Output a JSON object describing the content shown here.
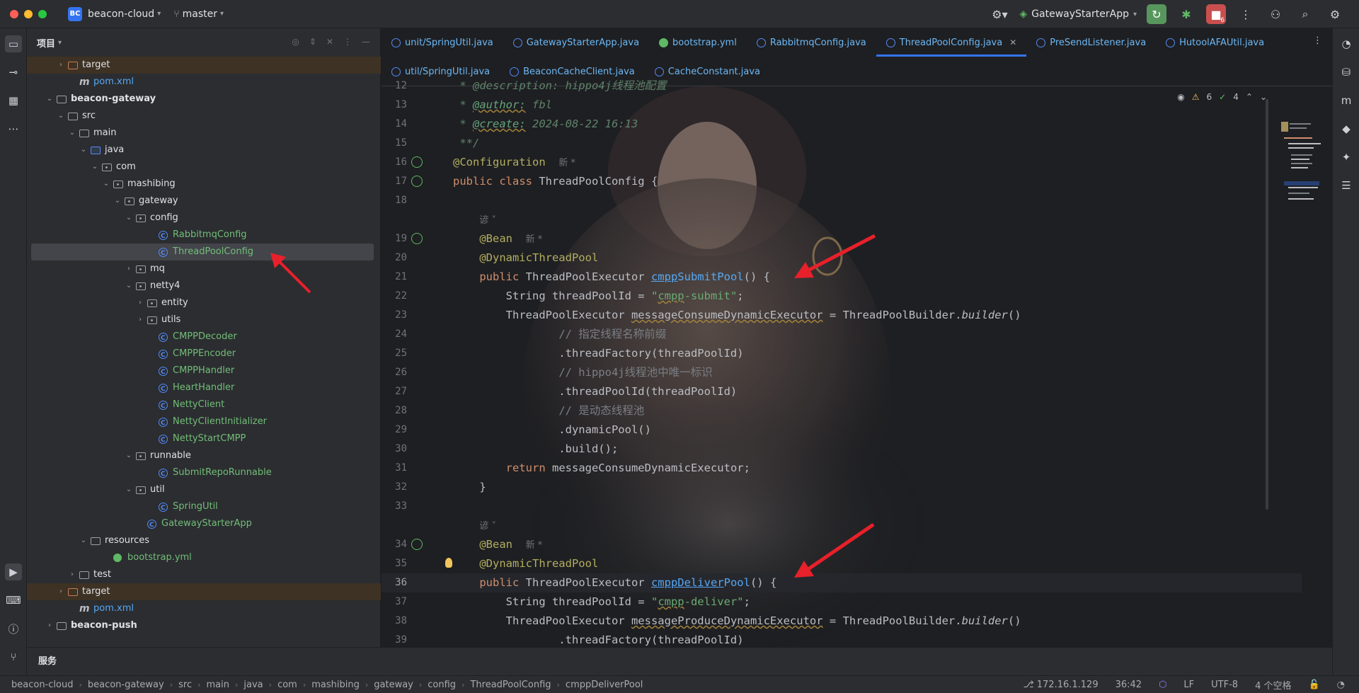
{
  "titlebar": {
    "project_badge": "BC",
    "project_name": "beacon-cloud",
    "branch": "master",
    "run_config": "GatewayStarterApp",
    "stop_count": "6"
  },
  "project_panel": {
    "title": "项目",
    "tree": [
      {
        "label": "target",
        "level": 1,
        "kind": "folder-excluded",
        "arrow": "right",
        "excluded": true
      },
      {
        "label": "pom.xml",
        "level": 2,
        "kind": "maven"
      },
      {
        "label": "beacon-gateway",
        "level": 0,
        "kind": "module",
        "arrow": "down",
        "bold": true
      },
      {
        "label": "src",
        "level": 1,
        "kind": "folder",
        "arrow": "down"
      },
      {
        "label": "main",
        "level": 2,
        "kind": "folder",
        "arrow": "down"
      },
      {
        "label": "java",
        "level": 3,
        "kind": "folder-src",
        "arrow": "down"
      },
      {
        "label": "com",
        "level": 4,
        "kind": "package",
        "arrow": "down"
      },
      {
        "label": "mashibing",
        "level": 5,
        "kind": "package",
        "arrow": "down"
      },
      {
        "label": "gateway",
        "level": 6,
        "kind": "package",
        "arrow": "down"
      },
      {
        "label": "config",
        "level": 7,
        "kind": "package",
        "arrow": "down"
      },
      {
        "label": "RabbitmqConfig",
        "level": 9,
        "kind": "class"
      },
      {
        "label": "ThreadPoolConfig",
        "level": 9,
        "kind": "class",
        "selected": true
      },
      {
        "label": "mq",
        "level": 7,
        "kind": "package",
        "arrow": "right"
      },
      {
        "label": "netty4",
        "level": 7,
        "kind": "package",
        "arrow": "down"
      },
      {
        "label": "entity",
        "level": 8,
        "kind": "package",
        "arrow": "right"
      },
      {
        "label": "utils",
        "level": 8,
        "kind": "package",
        "arrow": "right"
      },
      {
        "label": "CMPPDecoder",
        "level": 9,
        "kind": "class"
      },
      {
        "label": "CMPPEncoder",
        "level": 9,
        "kind": "class"
      },
      {
        "label": "CMPPHandler",
        "level": 9,
        "kind": "class"
      },
      {
        "label": "HeartHandler",
        "level": 9,
        "kind": "class"
      },
      {
        "label": "NettyClient",
        "level": 9,
        "kind": "class"
      },
      {
        "label": "NettyClientInitializer",
        "level": 9,
        "kind": "class"
      },
      {
        "label": "NettyStartCMPP",
        "level": 9,
        "kind": "class"
      },
      {
        "label": "runnable",
        "level": 7,
        "kind": "package",
        "arrow": "down"
      },
      {
        "label": "SubmitRepoRunnable",
        "level": 9,
        "kind": "class"
      },
      {
        "label": "util",
        "level": 7,
        "kind": "package",
        "arrow": "down"
      },
      {
        "label": "SpringUtil",
        "level": 9,
        "kind": "class"
      },
      {
        "label": "GatewayStarterApp",
        "level": 8,
        "kind": "class-main"
      },
      {
        "label": "resources",
        "level": 3,
        "kind": "folder-res",
        "arrow": "down"
      },
      {
        "label": "bootstrap.yml",
        "level": 5,
        "kind": "yml"
      },
      {
        "label": "test",
        "level": 2,
        "kind": "folder",
        "arrow": "right"
      },
      {
        "label": "target",
        "level": 1,
        "kind": "folder-excluded",
        "arrow": "right",
        "excluded": true
      },
      {
        "label": "pom.xml",
        "level": 2,
        "kind": "maven"
      },
      {
        "label": "beacon-push",
        "level": 0,
        "kind": "module",
        "arrow": "right",
        "bold": true
      }
    ]
  },
  "services_label": "服务",
  "editor": {
    "tabs_row1": [
      {
        "label": "unit/SpringUtil.java",
        "icon": "class"
      },
      {
        "label": "GatewayStarterApp.java",
        "icon": "class"
      },
      {
        "label": "bootstrap.yml",
        "icon": "yml"
      },
      {
        "label": "RabbitmqConfig.java",
        "icon": "class"
      },
      {
        "label": "ThreadPoolConfig.java",
        "icon": "class",
        "active": true
      },
      {
        "label": "PreSendListener.java",
        "icon": "class"
      },
      {
        "label": "HutoolAFAUtil.java",
        "icon": "class"
      }
    ],
    "tabs_row2": [
      {
        "label": "util/SpringUtil.java",
        "icon": "class"
      },
      {
        "label": "BeaconCacheClient.java",
        "icon": "class"
      },
      {
        "label": "CacheConstant.java",
        "icon": "class"
      }
    ],
    "inspections": {
      "warnings": "6",
      "weak": "4"
    },
    "current_line": 36
  },
  "code_lines": [
    {
      "n": "12",
      "html": "<span class='doc'> * @description: hippo4j线程池配置</span>"
    },
    {
      "n": "13",
      "html": "<span class='doc'> * </span><span class='doctag'>@author:</span><span class='doc'> fbl</span>"
    },
    {
      "n": "14",
      "html": "<span class='doc'> * </span><span class='doctag'>@create:</span><span class='doc'> 2024-08-22 16:13</span>"
    },
    {
      "n": "15",
      "html": "<span class='doc'> **/</span>"
    },
    {
      "n": "16",
      "html": "<span class='ann'>@Configuration</span>  <span class='hint'>新 *</span>",
      "gutter": true
    },
    {
      "n": "17",
      "html": "<span class='kw'>public class</span> ThreadPoolConfig {",
      "gutter": true
    },
    {
      "n": "18",
      "html": ""
    },
    {
      "n": "",
      "html": "    <span class='hint'>谚 ˅</span>"
    },
    {
      "n": "19",
      "html": "    <span class='ann'>@Bean</span>  <span class='hint'>新 *</span>",
      "gutter": true
    },
    {
      "n": "20",
      "html": "    <span class='ann'>@DynamicThreadPool</span>"
    },
    {
      "n": "21",
      "html": "    <span class='kw'>public</span> ThreadPoolExecutor <span class='fnl'>cmpp</span><span class='fn'>SubmitPool</span>() {"
    },
    {
      "n": "22",
      "html": "        String threadPoolId = <span class='str'>\"<span class='uw'>cmpp</span>-submit\"</span>;"
    },
    {
      "n": "23",
      "html": "        ThreadPoolExecutor <span class='uw'>messageConsumeDynamicExecutor</span> = ThreadPoolBuilder.<span class='ital'>builder</span>()"
    },
    {
      "n": "24",
      "html": "                <span class='cmt'>// 指定线程名称前缀</span>"
    },
    {
      "n": "25",
      "html": "                .threadFactory(threadPoolId)"
    },
    {
      "n": "26",
      "html": "                <span class='cmt'>// hippo4j线程池中唯一标识</span>"
    },
    {
      "n": "27",
      "html": "                .threadPoolId(threadPoolId)"
    },
    {
      "n": "28",
      "html": "                <span class='cmt'>// 是动态线程池</span>"
    },
    {
      "n": "29",
      "html": "                .dynamicPool()"
    },
    {
      "n": "30",
      "html": "                .build();"
    },
    {
      "n": "31",
      "html": "        <span class='kw'>return</span> messageConsumeDynamicExecutor;"
    },
    {
      "n": "32",
      "html": "    }"
    },
    {
      "n": "33",
      "html": ""
    },
    {
      "n": "",
      "html": "    <span class='hint'>谚 ˅</span>"
    },
    {
      "n": "34",
      "html": "    <span class='ann'>@Bean</span>  <span class='hint'>新 *</span>",
      "gutter": true
    },
    {
      "n": "35",
      "html": "    <span class='ann'>@DynamicThreadPool</span>",
      "bulb": true
    },
    {
      "n": "36",
      "html": "    <span class='kw'>public</span> ThreadPoolExecutor <span class='fnl'>cmppDeliver</span><span class='fn'>Pool</span>() {",
      "current": true
    },
    {
      "n": "37",
      "html": "        String threadPoolId = <span class='str'>\"<span class='uw'>cmpp</span>-deliver\"</span>;"
    },
    {
      "n": "38",
      "html": "        ThreadPoolExecutor <span class='uw'>messageProduceDynamicExecutor</span> = ThreadPoolBuilder.<span class='ital'>builder</span>()"
    },
    {
      "n": "39",
      "html": "                .threadFactory(threadPoolId)"
    }
  ],
  "statusbar": {
    "crumbs": [
      "beacon-cloud",
      "beacon-gateway",
      "src",
      "main",
      "java",
      "com",
      "mashibing",
      "gateway",
      "config",
      "ThreadPoolConfig",
      "cmppDeliverPool"
    ],
    "ip": "172.16.1.129",
    "position": "36:42",
    "line_sep": "LF",
    "encoding": "UTF-8",
    "indent": "4 个空格"
  },
  "colors": {
    "accent": "#3574f0",
    "arrow": "#e8202a",
    "run": "#57965c",
    "stop": "#c94f4f"
  }
}
